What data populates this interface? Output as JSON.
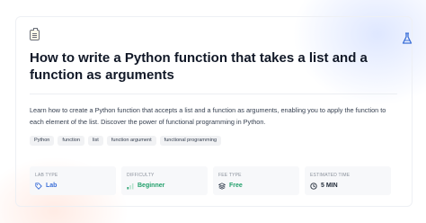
{
  "header": {
    "icon": "clipboard-icon",
    "corner_icon": "flask-icon",
    "title": "How to write a Python function that takes a list and a function as arguments"
  },
  "description": "Learn how to create a Python function that accepts a list and a function as arguments, enabling you to apply the function to each element of the list. Discover the power of functional programming in Python.",
  "tags": [
    "Python",
    "function",
    "list",
    "function argument",
    "functional programming"
  ],
  "info": [
    {
      "label": "LAB TYPE",
      "value": "Lab",
      "icon": "tag-icon",
      "color": "#3b6fd8"
    },
    {
      "label": "DIFFICULTY",
      "value": "Beginner",
      "icon": "signal-icon",
      "color": "#22a06b"
    },
    {
      "label": "FEE TYPE",
      "value": "Free",
      "icon": "stack-icon",
      "color": "#22a06b"
    },
    {
      "label": "ESTIMATED TIME",
      "value": "5 MIN",
      "icon": "clock-icon",
      "color": "#1f2937"
    }
  ]
}
